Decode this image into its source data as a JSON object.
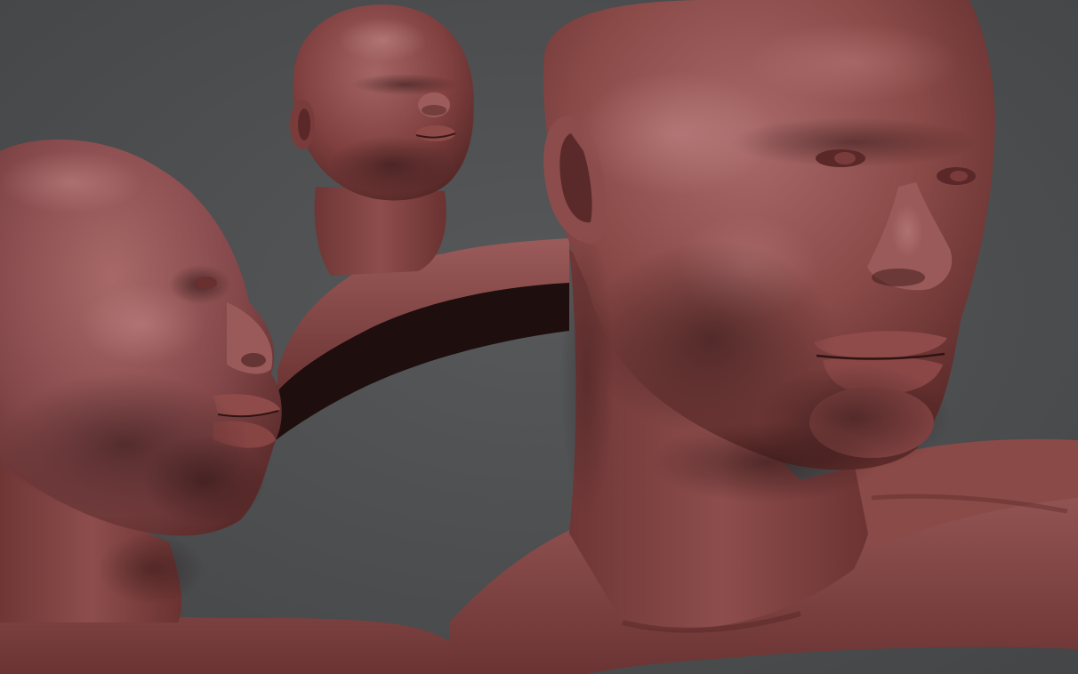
{
  "scene": {
    "description_visible_text": "",
    "colors": {
      "background": "#4e5052",
      "background_vignette": "#3f4143",
      "clay_base": "#8a4a48",
      "clay_highlight": "#b9797a",
      "clay_midtone": "#7a3f3e",
      "clay_shadow": "#3a1a1b",
      "clay_deep_shadow": "#24100f",
      "stubble": "#2b1414"
    },
    "subjects": [
      {
        "view": "three-quarter-right",
        "role": "large-bust"
      },
      {
        "view": "profile-left",
        "role": "side-bust"
      },
      {
        "view": "three-quarter-small",
        "role": "small-bust"
      }
    ]
  }
}
